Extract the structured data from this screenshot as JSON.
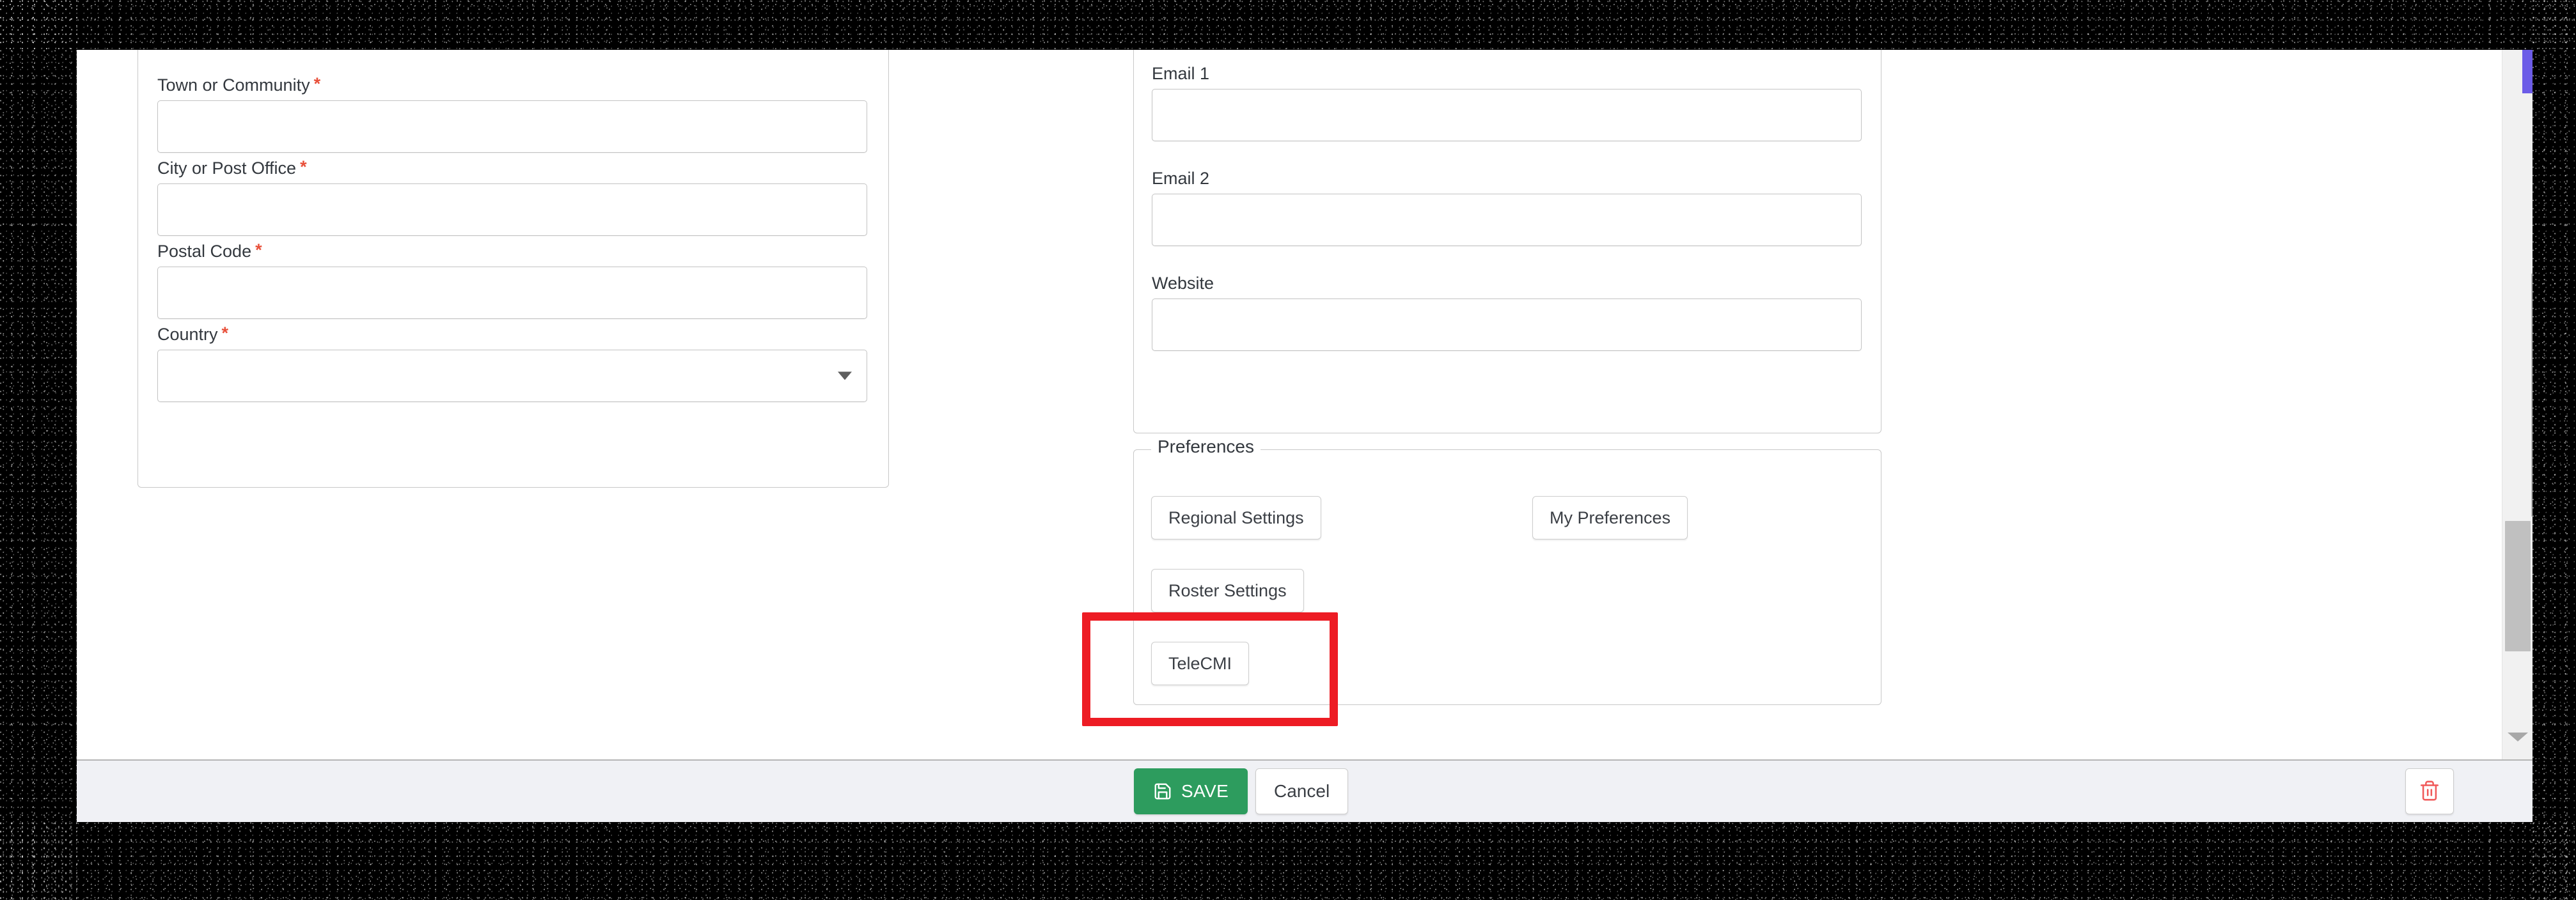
{
  "address_section": {
    "fields": [
      {
        "label": "Town or Community",
        "required": true,
        "value": "",
        "placeholder": "",
        "type": "text"
      },
      {
        "label": "City or Post Office",
        "required": true,
        "value": "",
        "placeholder": "",
        "type": "text"
      },
      {
        "label": "Postal Code",
        "required": true,
        "value": "",
        "placeholder": "",
        "type": "text"
      },
      {
        "label": "Country",
        "required": true,
        "value": "",
        "placeholder": "",
        "type": "select"
      }
    ],
    "required_marker": "*"
  },
  "contact_section": {
    "fields": [
      {
        "label": "Email 1",
        "required": false,
        "value": "",
        "placeholder": "",
        "type": "text"
      },
      {
        "label": "Email 2",
        "required": false,
        "value": "",
        "placeholder": "",
        "type": "text"
      },
      {
        "label": "Website",
        "required": false,
        "value": "",
        "placeholder": "",
        "type": "text"
      }
    ]
  },
  "preferences_section": {
    "legend": "Preferences",
    "buttons": [
      {
        "label": "Regional Settings",
        "highlighted": false
      },
      {
        "label": "My Preferences",
        "highlighted": false
      },
      {
        "label": "Roster Settings",
        "highlighted": false
      },
      {
        "label": "TeleCMI",
        "highlighted": true
      }
    ]
  },
  "footer": {
    "save_label": "SAVE",
    "cancel_label": "Cancel",
    "save_icon": "floppy-disk-icon",
    "delete_icon": "trash-icon"
  },
  "scrollbar": {
    "down_arrow_icon": "chevron-down-icon",
    "thumb_position_percent": 66
  },
  "annotation": {
    "type": "highlight-rectangle",
    "target": "TeleCMI",
    "color": "#ED1C24"
  },
  "colors": {
    "save_green": "#2D9C5E",
    "required_red": "#E8503A",
    "annotation_red": "#ED1C24",
    "trash_red": "#F05A5A",
    "accent_indigo": "#6C5CE7",
    "footer_bg": "#F0F1F5",
    "border_gray": "#C8C8C8"
  }
}
